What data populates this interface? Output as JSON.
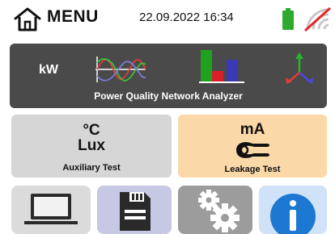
{
  "header": {
    "title": "MENU",
    "datetime": "22.09.2022  16:34",
    "icons": [
      "home-icon",
      "battery-icon",
      "wifi-off-icon"
    ]
  },
  "tiles": {
    "power_quality": {
      "unit": "kW",
      "label": "Power Quality Network Analyzer",
      "icons": [
        "sine-waves-icon",
        "bar-graph-icon",
        "phasor-diagram-icon"
      ]
    },
    "auxiliary": {
      "unit_temp": "°C",
      "unit_lux": "Lux",
      "label": "Auxiliary Test"
    },
    "leakage": {
      "unit": "mA",
      "label": "Leakage Test",
      "icon": "clamp-meter-icon"
    }
  },
  "bottom_buttons": [
    {
      "name": "pc-connection",
      "icon": "laptop-icon"
    },
    {
      "name": "memory",
      "icon": "floppy-disk-icon"
    },
    {
      "name": "settings",
      "icon": "gears-icon"
    },
    {
      "name": "info",
      "icon": "info-icon"
    }
  ],
  "colors": {
    "pq_tile": "#4a4a4a",
    "aux_tile": "#d6d6d6",
    "leak_tile": "#fbd8a8",
    "battery": "#2eab2e",
    "wifi_slash": "#e8252a",
    "info_blue": "#1d78d2",
    "bar_green": "#1fa21f",
    "bar_red": "#d9202a",
    "bar_blue": "#3a3ab8"
  }
}
